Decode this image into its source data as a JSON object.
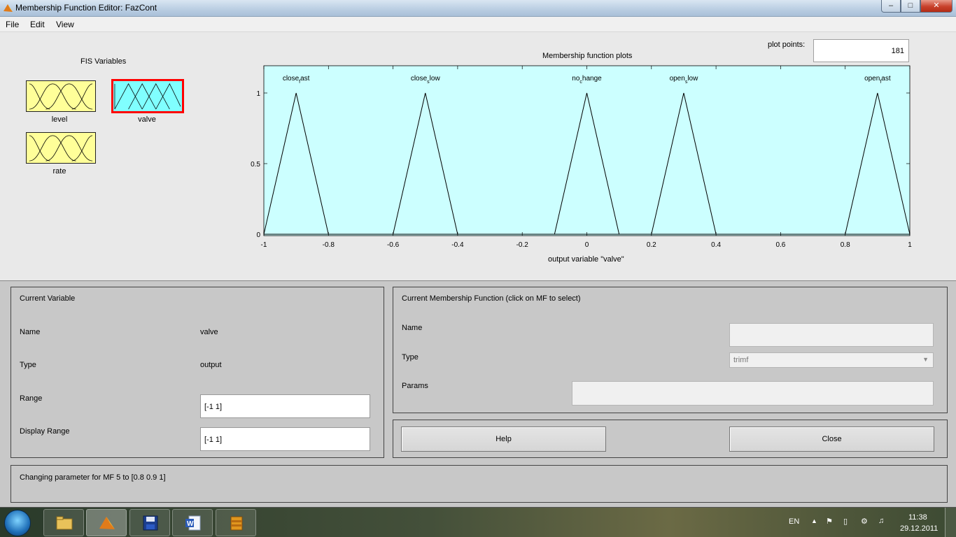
{
  "window": {
    "title": "Membership Function Editor: FazCont",
    "min_symbol": "–",
    "max_symbol": "□",
    "close_symbol": "✕"
  },
  "menu": {
    "file": "File",
    "edit": "Edit",
    "view": "View"
  },
  "fis": {
    "label": "FIS Variables",
    "variables": [
      {
        "name": "level",
        "type": "input"
      },
      {
        "name": "valve",
        "type": "output",
        "selected": true
      },
      {
        "name": "rate",
        "type": "input"
      }
    ]
  },
  "plot": {
    "title": "Membership function plots",
    "plot_points_label": "plot points:",
    "plot_points_value": "181",
    "xlabel": "output variable \"valve\""
  },
  "chart_data": {
    "type": "line",
    "title": "Membership function plots",
    "xlabel": "output variable \"valve\"",
    "ylabel": "",
    "xlim": [
      -1,
      1
    ],
    "ylim": [
      0,
      1
    ],
    "xticks": [
      "-1",
      "-0.8",
      "-0.6",
      "-0.4",
      "-0.2",
      "0",
      "0.2",
      "0.4",
      "0.6",
      "0.8",
      "1"
    ],
    "yticks": [
      "0",
      "0.5",
      "1"
    ],
    "series": [
      {
        "name": "close_fast",
        "label_main": "close",
        "label_sub": "f",
        "label_rest": "ast",
        "params": [
          -1,
          -0.9,
          -0.8
        ]
      },
      {
        "name": "close_slow",
        "label_main": "close",
        "label_sub": "s",
        "label_rest": "low",
        "params": [
          -0.6,
          -0.5,
          -0.4
        ]
      },
      {
        "name": "no_change",
        "label_main": "no",
        "label_sub": "c",
        "label_rest": "hange",
        "params": [
          -0.1,
          0,
          0.1
        ]
      },
      {
        "name": "open_slow",
        "label_main": "open",
        "label_sub": "s",
        "label_rest": "low",
        "params": [
          0.2,
          0.3,
          0.4
        ]
      },
      {
        "name": "open_fast",
        "label_main": "open",
        "label_sub": "f",
        "label_rest": "ast",
        "params": [
          0.8,
          0.9,
          1
        ]
      }
    ],
    "colors": {
      "background": "#ccffff",
      "line": "#000000"
    }
  },
  "current_variable": {
    "header": "Current Variable",
    "name_label": "Name",
    "name_value": "valve",
    "type_label": "Type",
    "type_value": "output",
    "range_label": "Range",
    "range_value": "[-1 1]",
    "display_range_label": "Display Range",
    "display_range_value": "[-1 1]"
  },
  "current_mf": {
    "header": "Current Membership Function (click on MF to select)",
    "name_label": "Name",
    "name_value": "",
    "type_label": "Type",
    "type_value": "trimf",
    "params_label": "Params",
    "params_value": ""
  },
  "buttons": {
    "help": "Help",
    "close": "Close"
  },
  "status": {
    "message": "Changing parameter for MF 5 to  [0.8 0.9 1]"
  },
  "taskbar": {
    "apps": [
      "file-explorer-icon",
      "matlab-icon",
      "save-floppy-icon",
      "word-icon",
      "archive-icon"
    ],
    "language": "EN",
    "time": "11:38",
    "date": "29.12.2011"
  }
}
